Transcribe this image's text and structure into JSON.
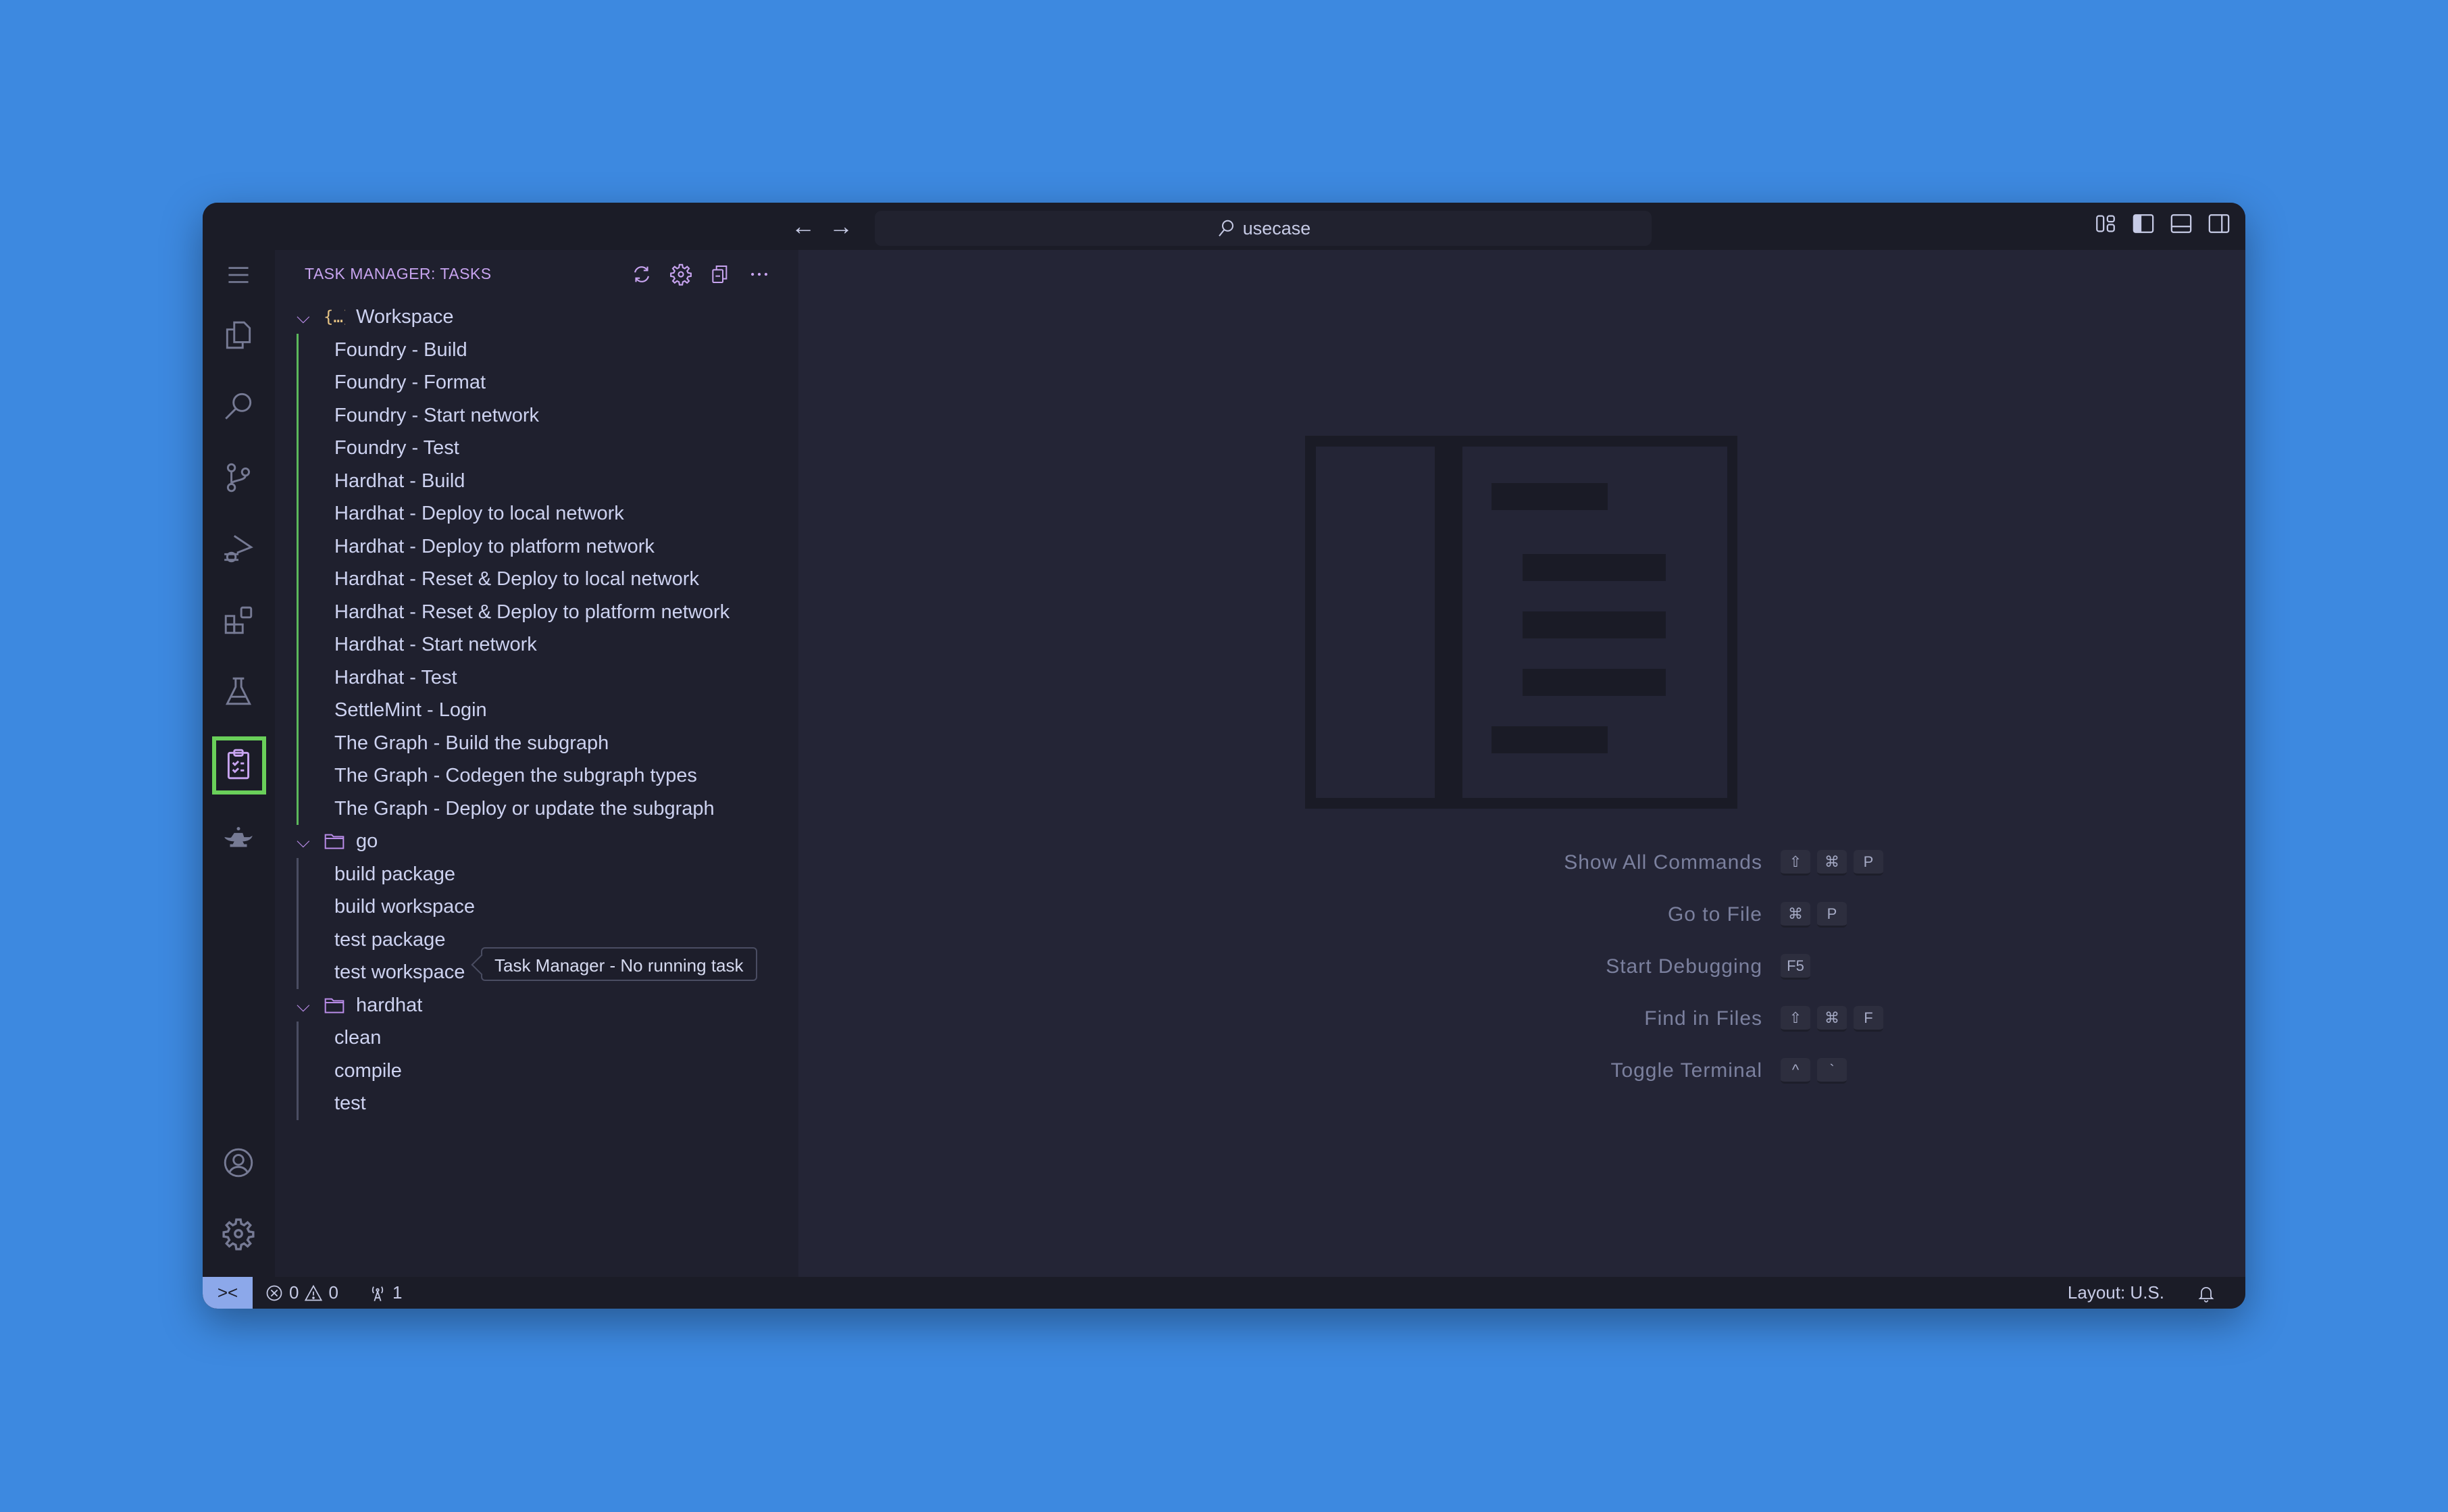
{
  "titlebar": {
    "back_icon": "arrow-left-icon",
    "forward_icon": "arrow-right-icon",
    "search_text": "usecase",
    "layout_icons": [
      "customize-layout-icon",
      "toggle-primary-sidebar-icon",
      "toggle-panel-icon",
      "toggle-secondary-sidebar-icon"
    ]
  },
  "activity_bar": {
    "items": [
      {
        "name": "menu",
        "icon": "hamburger-menu-icon"
      },
      {
        "name": "explorer",
        "icon": "files-icon"
      },
      {
        "name": "search",
        "icon": "search-icon"
      },
      {
        "name": "source-control",
        "icon": "source-control-icon"
      },
      {
        "name": "run-debug",
        "icon": "run-debug-icon"
      },
      {
        "name": "extensions",
        "icon": "extensions-icon"
      },
      {
        "name": "testing",
        "icon": "beaker-icon"
      },
      {
        "name": "task-manager",
        "icon": "clipboard-checklist-icon",
        "active": true
      },
      {
        "name": "genie",
        "icon": "magic-lamp-icon"
      }
    ],
    "bottom_items": [
      {
        "name": "accounts",
        "icon": "account-icon"
      },
      {
        "name": "manage",
        "icon": "gear-icon"
      }
    ]
  },
  "sidebar": {
    "title": "TASK MANAGER: TASKS",
    "actions": [
      "refresh-icon",
      "gear-icon",
      "collapse-all-icon",
      "more-icon"
    ],
    "groups": [
      {
        "label": "Workspace",
        "icon": "json-braces-icon",
        "tasks": [
          "Foundry - Build",
          "Foundry - Format",
          "Foundry - Start network",
          "Foundry - Test",
          "Hardhat - Build",
          "Hardhat - Deploy to local network",
          "Hardhat - Deploy to platform network",
          "Hardhat - Reset & Deploy to local network",
          "Hardhat - Reset & Deploy to platform network",
          "Hardhat - Start network",
          "Hardhat - Test",
          "SettleMint - Login",
          "The Graph - Build the subgraph",
          "The Graph - Codegen the subgraph types",
          "The Graph - Deploy or update the subgraph"
        ]
      },
      {
        "label": "go",
        "icon": "folder-icon",
        "tasks": [
          "build package",
          "build workspace",
          "test package",
          "test workspace"
        ]
      },
      {
        "label": "hardhat",
        "icon": "folder-icon",
        "tasks": [
          "clean",
          "compile",
          "test"
        ]
      }
    ]
  },
  "tooltip": {
    "text": "Task Manager - No running task"
  },
  "editor": {
    "shortcuts": [
      {
        "label": "Show All Commands",
        "keys": [
          "⇧",
          "⌘",
          "P"
        ]
      },
      {
        "label": "Go to File",
        "keys": [
          "⌘",
          "P"
        ]
      },
      {
        "label": "Start Debugging",
        "keys": [
          "F5"
        ]
      },
      {
        "label": "Find in Files",
        "keys": [
          "⇧",
          "⌘",
          "F"
        ]
      },
      {
        "label": "Toggle Terminal",
        "keys": [
          "^",
          "`"
        ]
      }
    ]
  },
  "statusbar": {
    "remote_icon": "remote-icon",
    "errors": "0",
    "warnings": "0",
    "ports": "1",
    "layout": "Layout: U.S.",
    "bell_icon": "bell-icon"
  },
  "colors": {
    "accent_purple": "#c8a4f0",
    "active_highlight": "#6ad05a",
    "remote_bg": "#8ca8ea",
    "background": "#3d89e0"
  }
}
